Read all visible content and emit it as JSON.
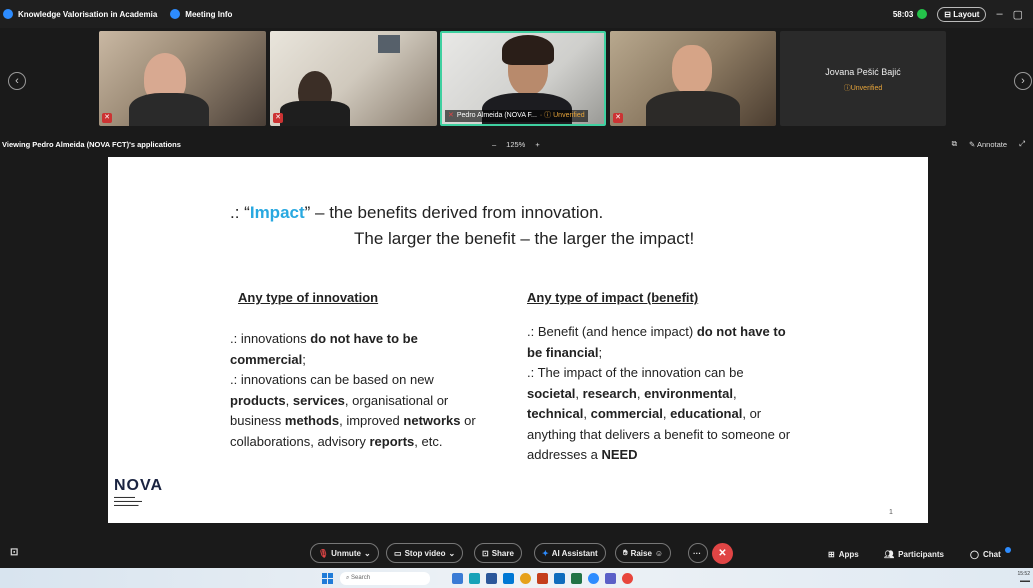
{
  "window": {
    "title": "Knowledge Valorisation in Academia",
    "meeting_info": "Meeting Info",
    "timer": "58:03",
    "layout_label": "Layout",
    "minimize": "–",
    "restore": "▢"
  },
  "participants": [
    {
      "name": "",
      "unverified": ""
    },
    {
      "name": "",
      "unverified": ""
    },
    {
      "name": "Pedro Almeida (NOVA F...",
      "unverified": "Unverified"
    },
    {
      "name": "",
      "unverified": ""
    },
    {
      "name": "Jovana Pešić Bajić",
      "unverified": "Unverified"
    }
  ],
  "share": {
    "viewing_label": "Viewing Pedro Almeida (NOVA FCT)'s applications",
    "zoom_minus": "–",
    "zoom_level": "125%",
    "zoom_plus": "+",
    "annotate_label": "Annotate"
  },
  "slide": {
    "title_prefix": ".: “",
    "title_highlight": "Impact",
    "title_suffix": "” – the benefits derived from innovation.",
    "subtitle": "The larger the benefit – the larger the impact!",
    "left_heading": "Any type of innovation",
    "right_heading": "Any type of impact (benefit)",
    "left": {
      "p1_a": ".: innovations ",
      "p1_b": "do not have to be commercial",
      "p1_c": ";",
      "p2_a": ".: innovations can be based on new ",
      "p2_b": "products",
      "p2_c": ", ",
      "p2_d": "services",
      "p2_e": ", organisational or business ",
      "p2_f": "methods",
      "p2_g": ", improved ",
      "p2_h": "networks",
      "p2_i": " or collaborations, advisory ",
      "p2_j": "reports",
      "p2_k": ", etc."
    },
    "right": {
      "p1_a": ".: Benefit (and hence impact) ",
      "p1_b": "do not have to be financial",
      "p1_c": ";",
      "p2_a": ".: The impact of the innovation can be ",
      "p2_b": "societal",
      "p2_c": ", ",
      "p2_d": "research",
      "p2_e": ", ",
      "p2_f": "environmental",
      "p2_g": ", ",
      "p2_h": "technical",
      "p2_i": ", ",
      "p2_j": "commercial",
      "p2_k": ", ",
      "p2_l": "educational",
      "p2_m": ", or anything that delivers a benefit to someone or addresses a ",
      "p2_n": "NEED"
    },
    "logo_text": "NOVA",
    "page_number": "1"
  },
  "toolbar": {
    "unmute": "Unmute",
    "stop_video": "Stop video",
    "share": "Share",
    "ai_assistant": "AI Assistant",
    "raise": "Raise",
    "more": "···",
    "apps": "Apps",
    "participants": "Participants",
    "chat": "Chat"
  },
  "taskbar": {
    "search_placeholder": "Search",
    "time": "15:52"
  },
  "colors": {
    "accent_blue": "#2d8cff",
    "impact_blue": "#28a8e0",
    "unverified_orange": "#e8a53a",
    "end_red": "#e04545"
  }
}
